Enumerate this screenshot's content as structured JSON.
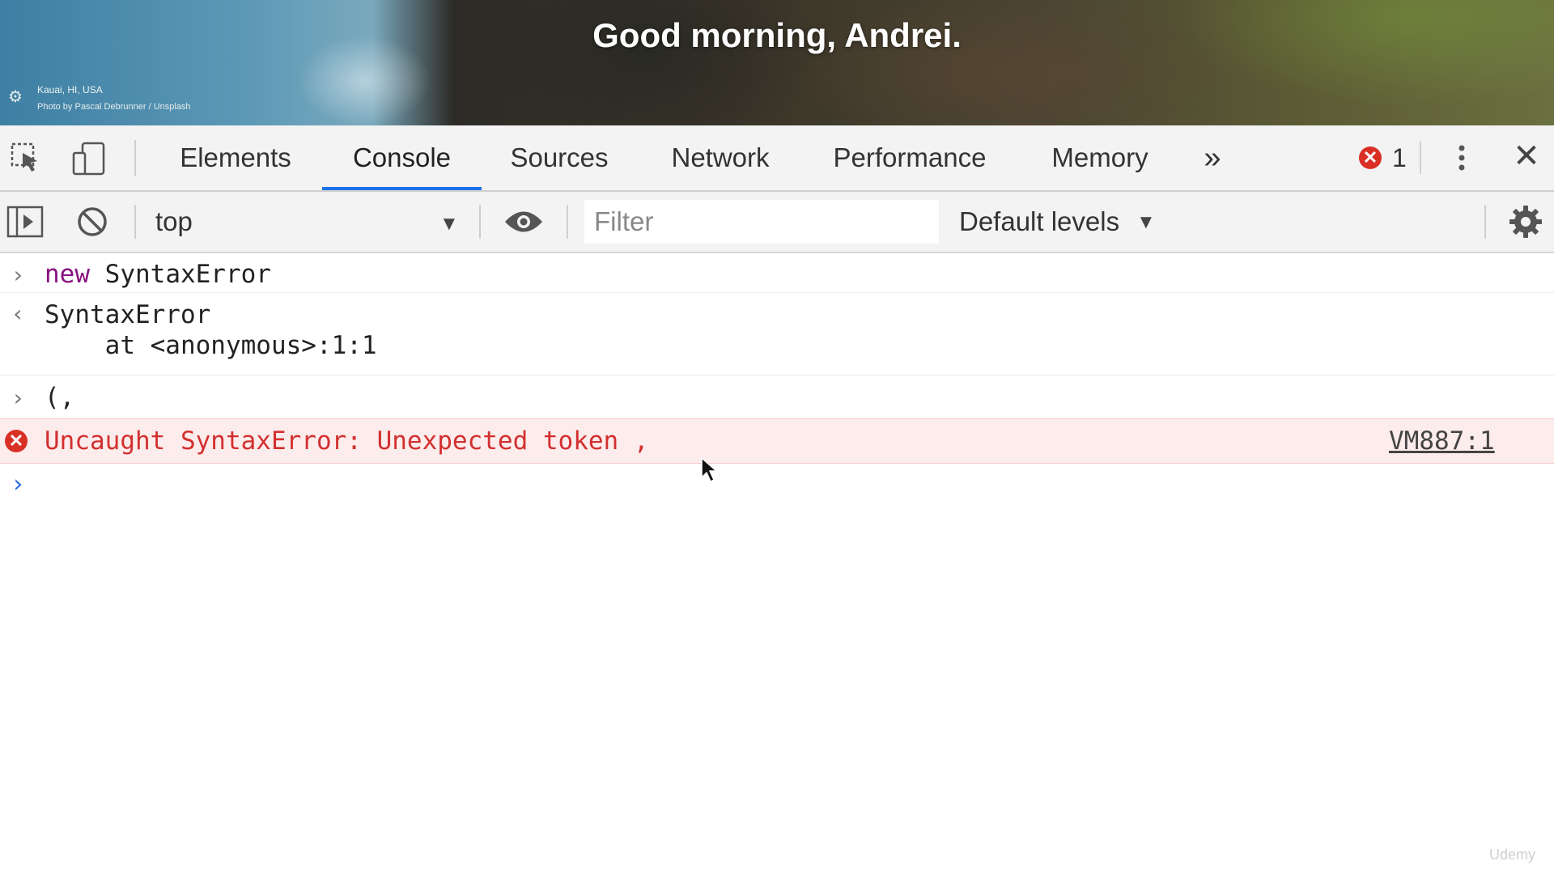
{
  "hero": {
    "greeting": "Good morning, Andrei.",
    "location": "Kauai, HI, USA",
    "credit": "Photo by Pascal Debrunner / Unsplash",
    "settings_icon": "gear-icon"
  },
  "devtools": {
    "tabs": [
      {
        "label": "Elements"
      },
      {
        "label": "Console"
      },
      {
        "label": "Sources"
      },
      {
        "label": "Network"
      },
      {
        "label": "Performance"
      },
      {
        "label": "Memory"
      }
    ],
    "active_tab": "Console",
    "more_tabs_icon": "»",
    "error_count": "1",
    "close_symbol": "✕"
  },
  "console_toolbar": {
    "context": "top",
    "filter_placeholder": "Filter",
    "levels": "Default levels"
  },
  "console": {
    "entries": [
      {
        "kind": "input",
        "keyword": "new",
        "text": " SyntaxError"
      },
      {
        "kind": "result",
        "text": "SyntaxError",
        "detail": "    at <anonymous>:1:1"
      },
      {
        "kind": "input",
        "text": "(,"
      },
      {
        "kind": "error",
        "text": "Uncaught SyntaxError: Unexpected token ,",
        "source": "VM887:1"
      }
    ]
  },
  "watermark": "Udemy",
  "colors": {
    "accent": "#1a73e8",
    "error": "#d93025",
    "error_bg": "#fdecec",
    "keyword": "#881280"
  }
}
